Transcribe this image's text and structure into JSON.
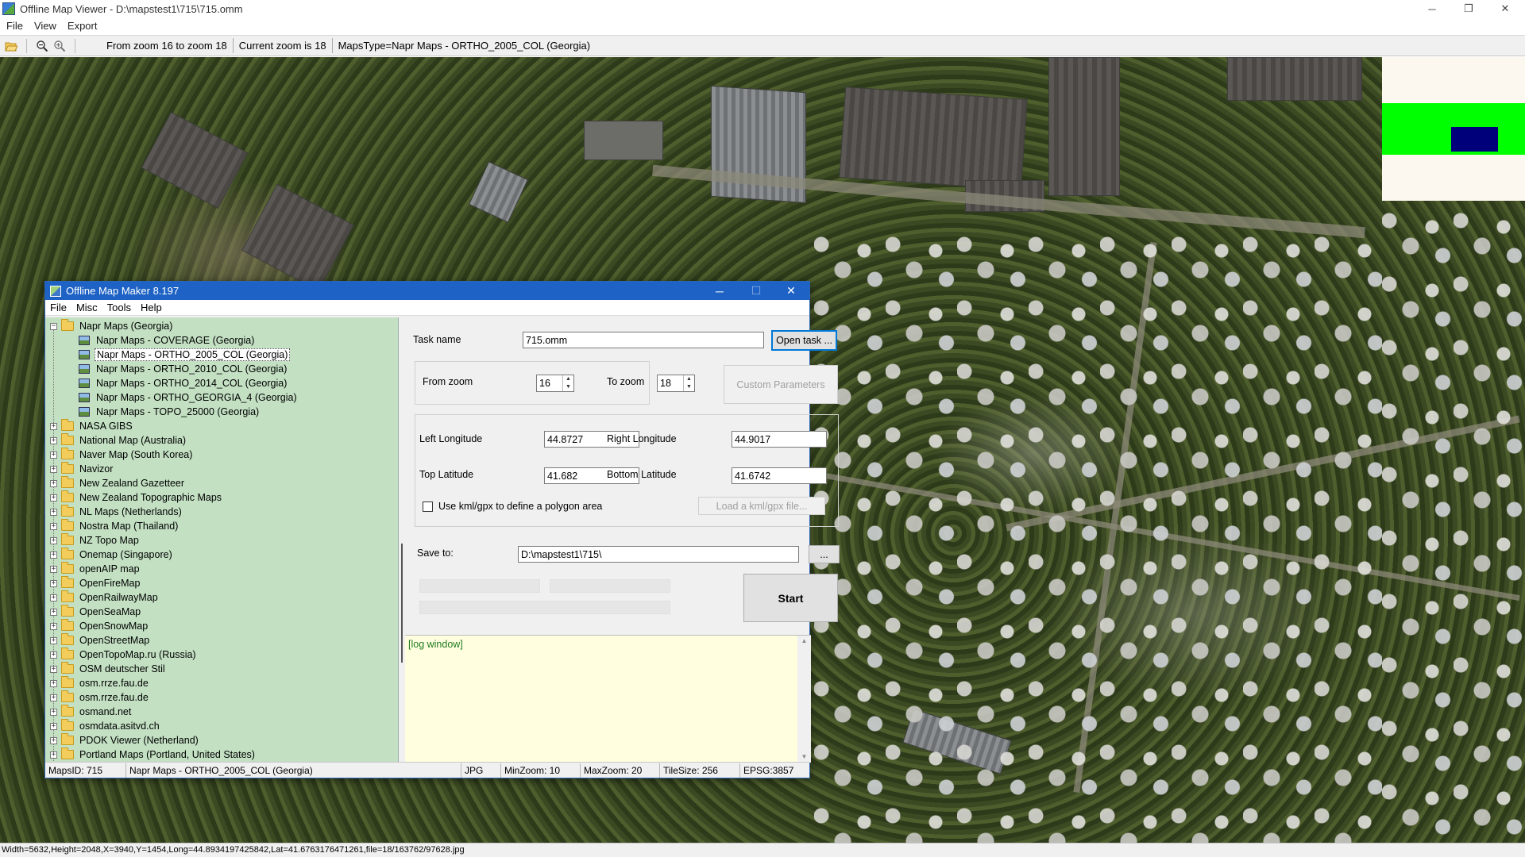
{
  "window": {
    "title": "Offline Map Viewer - D:\\mapstest1\\715\\715.omm",
    "minimize": "─",
    "maximize": "❐",
    "close": "✕"
  },
  "menu": [
    "File",
    "View",
    "Export"
  ],
  "toolbar": {
    "zoom_range": "From zoom 16 to zoom 18",
    "current_zoom": "Current zoom is 18",
    "maps_type": "MapsType=Napr Maps - ORTHO_2005_COL (Georgia)"
  },
  "statusbar": {
    "text": "Width=5632,Height=2048,X=3940,Y=1454,Long=44.8934197425842,Lat=41.6763176471261,file=18/163762/97628.jpg"
  },
  "minimap": {
    "band_color": "#00ff00",
    "view_color": "#00007a",
    "bg_color": "#fdf8ef"
  },
  "dialog": {
    "title": "Offline Map Maker 8.197",
    "minimize": "─",
    "maximize": "☐",
    "close": "✕",
    "menu": [
      "File",
      "Misc",
      "Tools",
      "Help"
    ],
    "tree": {
      "root": "Napr Maps (Georgia)",
      "children": [
        "Napr Maps - COVERAGE (Georgia)",
        "Napr Maps - ORTHO_2005_COL (Georgia)",
        "Napr Maps - ORTHO_2010_COL (Georgia)",
        "Napr Maps - ORTHO_2014_COL (Georgia)",
        "Napr Maps - ORTHO_GEORGIA_4 (Georgia)",
        "Napr Maps - TOPO_25000 (Georgia)"
      ],
      "selected_index": 1,
      "folders": [
        "NASA GIBS",
        "National Map (Australia)",
        "Naver Map (South Korea)",
        "Navizor",
        "New Zealand Gazetteer",
        "New Zealand Topographic Maps",
        "NL Maps (Netherlands)",
        "Nostra Map (Thailand)",
        "NZ Topo Map",
        "Onemap (Singapore)",
        "openAIP map",
        "OpenFireMap",
        "OpenRailwayMap",
        "OpenSeaMap",
        "OpenSnowMap",
        "OpenStreetMap",
        "OpenTopoMap.ru (Russia)",
        "OSM deutscher Stil",
        "osm.rrze.fau.de",
        "osm.rrze.fau.de",
        "osmand.net",
        "osmdata.asitvd.ch",
        "PDOK Viewer (Netherland)",
        "Portland Maps (Portland, United States)"
      ],
      "expand_glyph": "+",
      "collapse_glyph": "−"
    },
    "form": {
      "task_name_label": "Task name",
      "task_name_value": "715.omm",
      "open_task_label": "Open task ...",
      "from_zoom_label": "From zoom",
      "from_zoom_value": "16",
      "to_zoom_label": "To zoom",
      "to_zoom_value": "18",
      "custom_params_label": "Custom Parameters",
      "left_lon_label": "Left Longitude",
      "left_lon_value": "44.8727",
      "right_lon_label": "Right Longitude",
      "right_lon_value": "44.9017",
      "top_lat_label": "Top Latitude",
      "top_lat_value": "41.682",
      "bottom_lat_label": "Bottom Latitude",
      "bottom_lat_value": "41.6742",
      "kml_checkbox_label": "Use kml/gpx to define a polygon area",
      "kml_checked": false,
      "load_kml_label": "Load a kml/gpx file...",
      "save_to_label": "Save to:",
      "save_to_value": "D:\\mapstest1\\715\\",
      "browse_label": "...",
      "start_label": "Start"
    },
    "log": {
      "text": "[log window]",
      "up": "▲",
      "down": "▼"
    },
    "status": {
      "maps_id": "MapsID: 715",
      "maps_name": "Napr Maps - ORTHO_2005_COL (Georgia)",
      "format": "JPG",
      "min_zoom": "MinZoom: 10",
      "max_zoom": "MaxZoom: 20",
      "tile_size": "TileSize: 256",
      "epsg": "EPSG:3857"
    }
  }
}
